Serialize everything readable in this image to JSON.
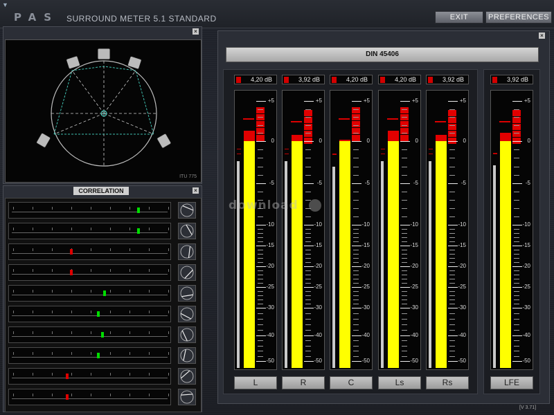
{
  "app": {
    "logo": "PAS",
    "title": "SURROUND METER 5.1 STANDARD",
    "version": "[V 3.71]",
    "watermark": "download"
  },
  "toolbar": {
    "exit_label": "EXIT",
    "preferences_label": "PREFERENCES"
  },
  "surround": {
    "layout_label": "ITU 775",
    "speakers": [
      "C",
      "L",
      "R",
      "Ls",
      "Rs"
    ]
  },
  "correlation": {
    "title": "CORRELATION",
    "rows": [
      {
        "value": 0.62,
        "color": "#00dd00",
        "icon": "L-R"
      },
      {
        "value": 0.62,
        "color": "#00dd00",
        "icon": "C-Ls"
      },
      {
        "value": -0.25,
        "color": "#dd0000",
        "icon": "L-Ls"
      },
      {
        "value": -0.25,
        "color": "#dd0000",
        "icon": "R-Rs"
      },
      {
        "value": 0.18,
        "color": "#00dd00",
        "icon": "C-L"
      },
      {
        "value": 0.1,
        "color": "#00dd00",
        "icon": "C-R"
      },
      {
        "value": 0.15,
        "color": "#00dd00",
        "icon": "L-Rs"
      },
      {
        "value": 0.1,
        "color": "#00dd00",
        "icon": "R-Ls"
      },
      {
        "value": -0.3,
        "color": "#dd0000",
        "icon": "Ls-Rs"
      },
      {
        "value": -0.3,
        "color": "#dd0000",
        "icon": "C-Rs"
      }
    ]
  },
  "meter": {
    "standard": "DIN 45406",
    "scale": [
      "+5",
      "0",
      "-5",
      "-10",
      "-15",
      "-20",
      "-25",
      "-30",
      "-40",
      "-50"
    ],
    "channels": [
      {
        "name": "L",
        "readout": "4,20 dB",
        "peak_db": 4.2,
        "level_db": 1.3
      },
      {
        "name": "R",
        "readout": "3,92 dB",
        "peak_db": 3.92,
        "level_db": 0.8
      },
      {
        "name": "C",
        "readout": "4,20 dB",
        "peak_db": 4.2,
        "level_db": 0.2
      },
      {
        "name": "Ls",
        "readout": "4,20 dB",
        "peak_db": 4.2,
        "level_db": 1.3
      },
      {
        "name": "Rs",
        "readout": "3,92 dB",
        "peak_db": 3.92,
        "level_db": 0.8
      },
      {
        "name": "LFE",
        "readout": "3,92 dB",
        "peak_db": 3.92,
        "level_db": 1.0
      }
    ]
  },
  "colors": {
    "level": "#ffff00",
    "clip": "#e20000",
    "panel": "#2b2e36"
  }
}
